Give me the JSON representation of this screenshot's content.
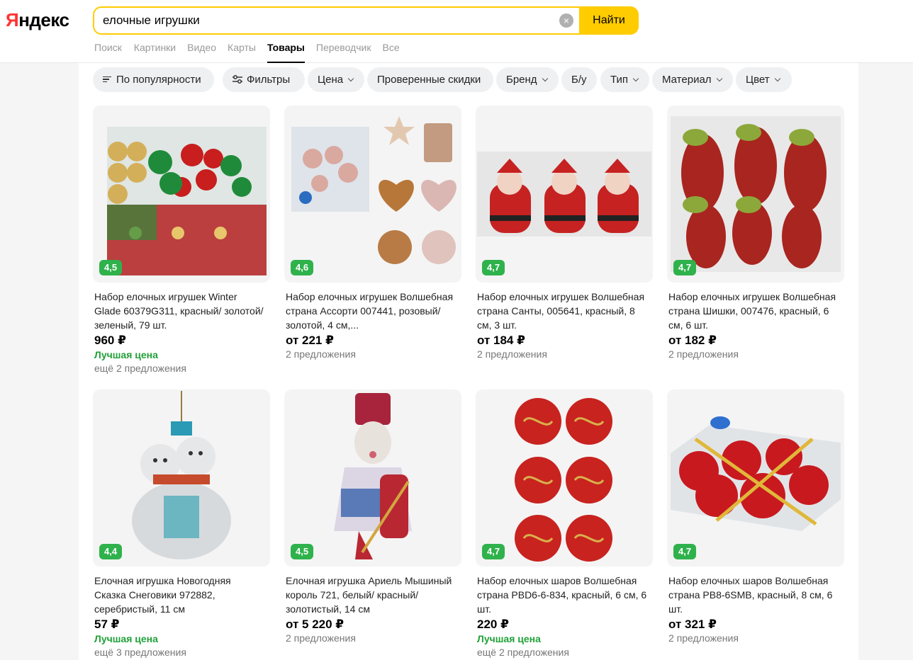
{
  "logo": {
    "first": "Я",
    "rest": "ндекс"
  },
  "search": {
    "query": "елочные игрушки",
    "clear_icon": "×",
    "button": "Найти"
  },
  "tabs": [
    "Поиск",
    "Картинки",
    "Видео",
    "Карты",
    "Товары",
    "Переводчик",
    "Все"
  ],
  "active_tab": "Товары",
  "filters": {
    "sort": "По популярности",
    "filters": "Фильтры",
    "price": "Цена",
    "discounts": "Проверенные скидки",
    "brand": "Бренд",
    "used": "Б/у",
    "type": "Тип",
    "material": "Материал",
    "color": "Цвет"
  },
  "products": [
    {
      "rating": "4,5",
      "title": "Набор елочных игрушек Winter Glade 60379G311, красный/ золотой/зеленый, 79 шт.",
      "price": "960 ₽",
      "best": "Лучшая цена",
      "offers": "ещё 2 предложения"
    },
    {
      "rating": "4,6",
      "title": "Набор елочных игрушек Волшебная страна Ассорти 007441, розовый/золотой, 4 см,...",
      "price": "от 221 ₽",
      "offers": "2 предложения"
    },
    {
      "rating": "4,7",
      "title": "Набор елочных игрушек Волшебная страна Санты, 005641, красный, 8 см, 3 шт.",
      "price": "от 184 ₽",
      "offers": "2 предложения"
    },
    {
      "rating": "4,7",
      "title": "Набор елочных игрушек Волшебная страна Шишки, 007476, красный, 6 см, 6 шт.",
      "price": "от 182 ₽",
      "offers": "2 предложения"
    },
    {
      "rating": "4,4",
      "title": "Елочная игрушка Новогодняя Сказка Снеговики 972882, серебристый, 11 см",
      "price": "57 ₽",
      "best": "Лучшая цена",
      "offers": "ещё 3 предложения"
    },
    {
      "rating": "4,5",
      "title": "Елочная игрушка Ариель Мышиный король 721, белый/ красный/золотистый, 14 см",
      "price": "от 5 220 ₽",
      "offers": "2 предложения"
    },
    {
      "rating": "4,7",
      "title": "Набор елочных шаров Волшебная страна PBD6-6-834, красный, 6 см, 6 шт.",
      "price": "220 ₽",
      "best": "Лучшая цена",
      "offers": "ещё 2 предложения"
    },
    {
      "rating": "4,7",
      "title": "Набор елочных шаров Волшебная страна PB8-6SMB, красный, 8 см, 6 шт.",
      "price": "от 321 ₽",
      "offers": "2 предложения"
    }
  ]
}
